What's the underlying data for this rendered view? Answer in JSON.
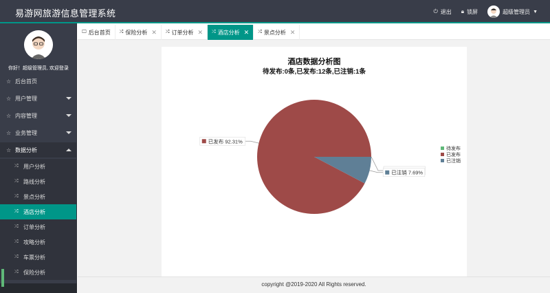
{
  "header": {
    "brand": "易游网旅游信息管理系统",
    "logout": "退出",
    "lock": "锁屏",
    "user": "超级管理员"
  },
  "sidebar": {
    "greeting": "你好！超级管理员, 欢迎登录",
    "items": [
      {
        "label": "后台首页",
        "icon": "star-icon"
      },
      {
        "label": "用户管理",
        "icon": "star-icon",
        "arrow": "down"
      },
      {
        "label": "内容管理",
        "icon": "star-icon",
        "arrow": "down"
      },
      {
        "label": "业务管理",
        "icon": "star-icon",
        "arrow": "down"
      },
      {
        "label": "数据分析",
        "icon": "star-icon",
        "arrow": "up"
      }
    ],
    "subitems": [
      {
        "label": "用户分析"
      },
      {
        "label": "路线分析"
      },
      {
        "label": "景点分析"
      },
      {
        "label": "酒店分析",
        "active": true
      },
      {
        "label": "订单分析"
      },
      {
        "label": "攻略分析"
      },
      {
        "label": "车票分析"
      },
      {
        "label": "保险分析"
      }
    ]
  },
  "tabs": [
    {
      "label": "后台首页",
      "icon": "monitor-icon",
      "closable": false
    },
    {
      "label": "保险分析",
      "closable": true
    },
    {
      "label": "订单分析",
      "closable": true
    },
    {
      "label": "酒店分析",
      "closable": true,
      "active": true
    },
    {
      "label": "景点分析",
      "closable": true
    }
  ],
  "chart_data": {
    "type": "pie",
    "title": "酒店数据分析图",
    "subtitle": "待发布:0条,已发布:12条,已注销:1条",
    "slices": [
      {
        "name": "待发布",
        "value": 0,
        "percent": "0.00%",
        "color": "#5fb878"
      },
      {
        "name": "已发布",
        "value": 12,
        "percent": "92.31%",
        "color": "#9e4a48"
      },
      {
        "name": "已注销",
        "value": 1,
        "percent": "7.69%",
        "color": "#5f7f96"
      }
    ],
    "legend_position": "right"
  },
  "footer": {
    "copyright": "copyright @2019-2020 All Rights reserved."
  }
}
